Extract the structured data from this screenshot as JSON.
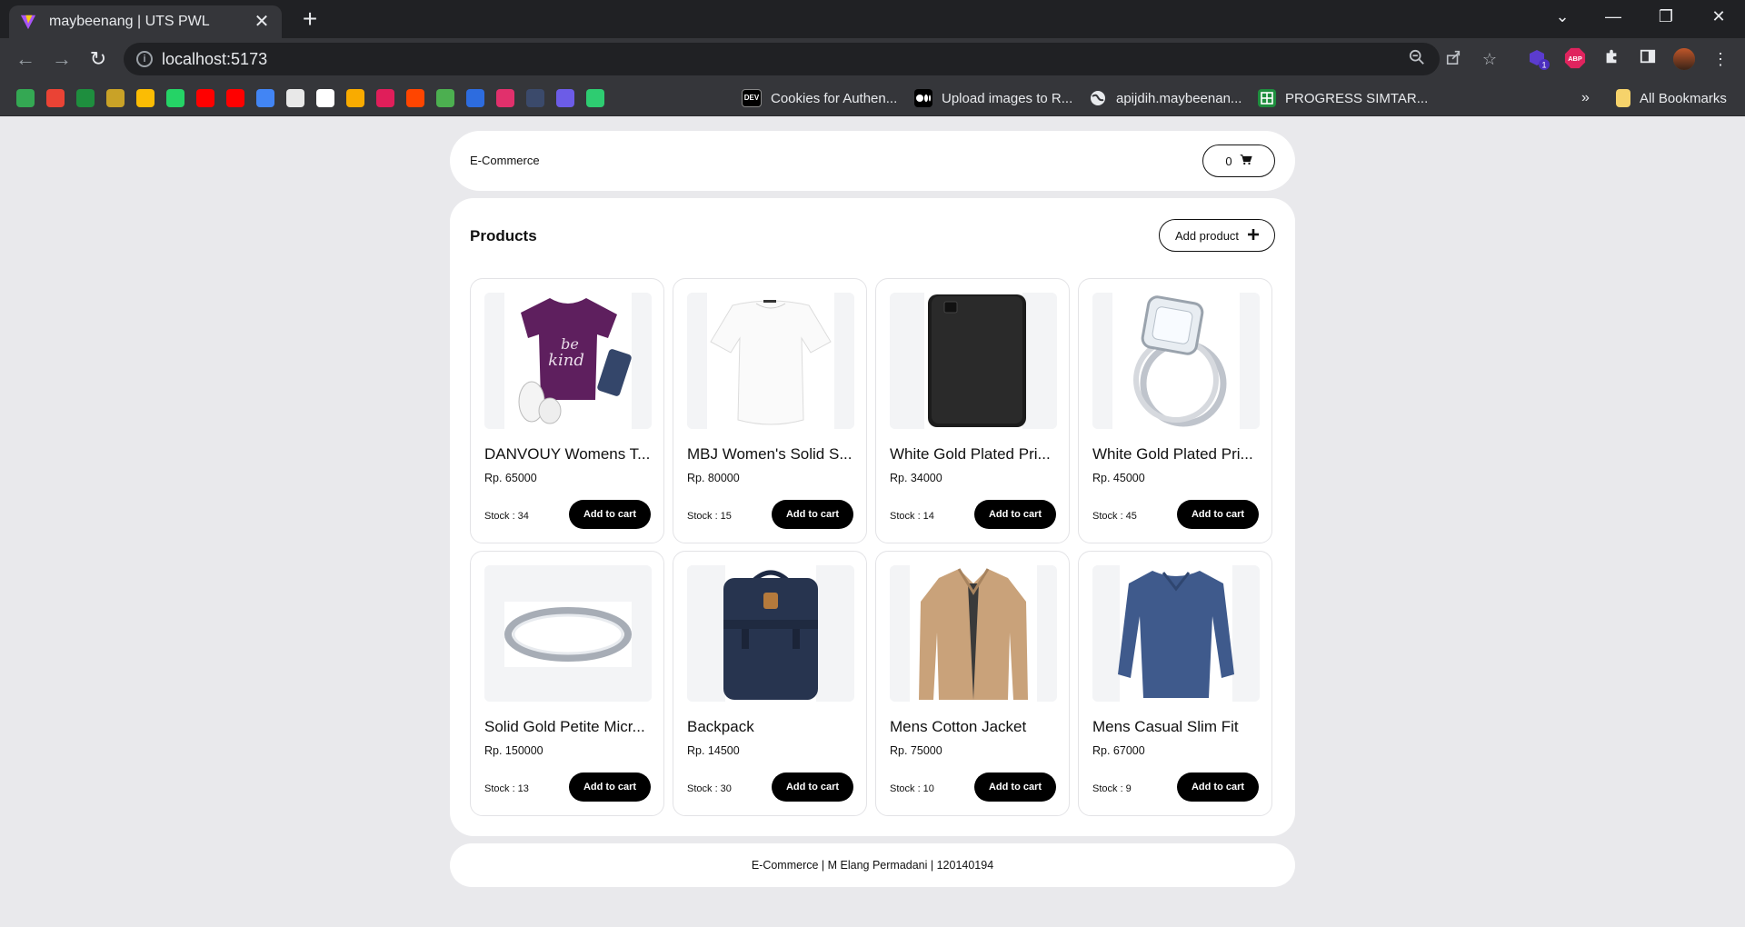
{
  "browser": {
    "tab_title": "maybeenang | UTS PWL",
    "url": "localhost:5173",
    "bookmarks": [
      {
        "icon": "google-drive-icon",
        "color": "#34a853"
      },
      {
        "icon": "gmail-icon",
        "color": "#ea4335"
      },
      {
        "icon": "green-plus-icon",
        "color": "#1e8e3e"
      },
      {
        "icon": "feather-icon",
        "color": "#c9a227"
      },
      {
        "icon": "keep-icon",
        "color": "#fbbc04"
      },
      {
        "icon": "whatsapp-icon",
        "color": "#25d366"
      },
      {
        "icon": "youtube-icon",
        "color": "#ff0000"
      },
      {
        "icon": "youtube-music-icon",
        "color": "#ff0000"
      },
      {
        "icon": "translate-icon",
        "color": "#4285f4"
      },
      {
        "icon": "bookmark-doc-icon",
        "color": "#e8e8e8"
      },
      {
        "icon": "github-icon",
        "color": "#ffffff"
      },
      {
        "icon": "classroom-icon",
        "color": "#f9ab00"
      },
      {
        "icon": "slack-icon",
        "color": "#e01e5a"
      },
      {
        "icon": "reddit-icon",
        "color": "#ff4500"
      },
      {
        "icon": "pin-icon",
        "color": "#4caf50"
      },
      {
        "icon": "s-logo-icon",
        "color": "#2d6cdf"
      },
      {
        "icon": "instagram-icon",
        "color": "#e1306c"
      },
      {
        "icon": "tds-icon",
        "color": "#3b4a6b"
      },
      {
        "icon": "list-icon",
        "color": "#6c5ce7"
      },
      {
        "icon": "asterisk-icon",
        "color": "#2ecc71"
      }
    ],
    "named_bookmarks": [
      {
        "icon": "dev-icon",
        "label": "Cookies for Authen..."
      },
      {
        "icon": "medium-icon",
        "label": "Upload images to R..."
      },
      {
        "icon": "globe-icon",
        "label": "apijdih.maybeenan..."
      },
      {
        "icon": "sheets-icon",
        "label": "PROGRESS SIMTAR..."
      }
    ],
    "all_bookmarks_label": "All Bookmarks",
    "extension_badge": "1",
    "abp_label": "ABP"
  },
  "navbar": {
    "brand": "E-Commerce",
    "cart_count": "0"
  },
  "products_section": {
    "title": "Products",
    "add_product_label": "Add product"
  },
  "products": [
    {
      "name": "DANVOUY Womens T...",
      "price": "Rp. 65000",
      "stock": "Stock : 34",
      "button": "Add to cart",
      "image": "purple-tshirt"
    },
    {
      "name": "MBJ Women's Solid S...",
      "price": "Rp. 80000",
      "stock": "Stock : 15",
      "button": "Add to cart",
      "image": "white-top"
    },
    {
      "name": "White Gold Plated Pri...",
      "price": "Rp. 34000",
      "stock": "Stock : 14",
      "button": "Add to cart",
      "image": "black-hard-drive"
    },
    {
      "name": "White Gold Plated Pri...",
      "price": "Rp. 45000",
      "stock": "Stock : 45",
      "button": "Add to cart",
      "image": "diamond-ring"
    },
    {
      "name": "Solid Gold Petite Micr...",
      "price": "Rp. 150000",
      "stock": "Stock : 13",
      "button": "Add to cart",
      "image": "silver-band-ring"
    },
    {
      "name": "Backpack",
      "price": "Rp. 14500",
      "stock": "Stock : 30",
      "button": "Add to cart",
      "image": "navy-backpack"
    },
    {
      "name": "Mens Cotton Jacket",
      "price": "Rp. 75000",
      "stock": "Stock : 10",
      "button": "Add to cart",
      "image": "tan-jacket"
    },
    {
      "name": "Mens Casual Slim Fit",
      "price": "Rp. 67000",
      "stock": "Stock : 9",
      "button": "Add to cart",
      "image": "blue-longsleeve"
    }
  ],
  "footer": {
    "text": "E-Commerce | M Elang Permadani | 120140194"
  }
}
